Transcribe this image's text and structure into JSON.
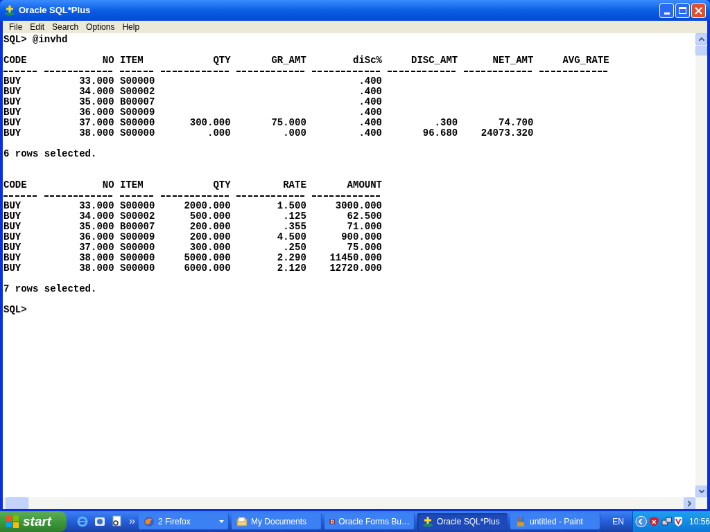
{
  "window": {
    "title": "Oracle SQL*Plus"
  },
  "menu": [
    "File",
    "Edit",
    "Search",
    "Options",
    "Help"
  ],
  "console": {
    "command_line": {
      "prompt": "SQL>",
      "command": "@invhd"
    },
    "results": [
      {
        "columns": [
          {
            "name": "CODE",
            "kind": "text"
          },
          {
            "name": "NO",
            "kind": "number"
          },
          {
            "name": "ITEM",
            "kind": "text"
          },
          {
            "name": "QTY",
            "kind": "number"
          },
          {
            "name": "GR_AMT",
            "kind": "number"
          },
          {
            "name": "diSc%",
            "kind": "number"
          },
          {
            "name": "DISC_AMT",
            "kind": "number"
          },
          {
            "name": "NET_AMT",
            "kind": "number"
          },
          {
            "name": "AVG_RATE",
            "kind": "number"
          }
        ],
        "rows": [
          [
            "BUY",
            "33.000",
            "S00000",
            null,
            null,
            ".400",
            null,
            null,
            null
          ],
          [
            "BUY",
            "34.000",
            "S00002",
            null,
            null,
            ".400",
            null,
            null,
            null
          ],
          [
            "BUY",
            "35.000",
            "B00007",
            null,
            null,
            ".400",
            null,
            null,
            null
          ],
          [
            "BUY",
            "36.000",
            "S00009",
            null,
            null,
            ".400",
            null,
            null,
            null
          ],
          [
            "BUY",
            "37.000",
            "S00000",
            "300.000",
            "75.000",
            ".400",
            ".300",
            "74.700",
            null
          ],
          [
            "BUY",
            "38.000",
            "S00000",
            ".000",
            ".000",
            ".400",
            "96.680",
            "24073.320",
            null
          ]
        ],
        "footer": "6 rows selected."
      },
      {
        "columns": [
          {
            "name": "CODE",
            "kind": "text"
          },
          {
            "name": "NO",
            "kind": "number"
          },
          {
            "name": "ITEM",
            "kind": "text"
          },
          {
            "name": "QTY",
            "kind": "number"
          },
          {
            "name": "RATE",
            "kind": "number"
          },
          {
            "name": "AMOUNT",
            "kind": "number"
          }
        ],
        "rows": [
          [
            "BUY",
            "33.000",
            "S00000",
            "2000.000",
            "1.500",
            "3000.000"
          ],
          [
            "BUY",
            "34.000",
            "S00002",
            "500.000",
            ".125",
            "62.500"
          ],
          [
            "BUY",
            "35.000",
            "B00007",
            "200.000",
            ".355",
            "71.000"
          ],
          [
            "BUY",
            "36.000",
            "S00009",
            "200.000",
            "4.500",
            "900.000"
          ],
          [
            "BUY",
            "37.000",
            "S00000",
            "300.000",
            ".250",
            "75.000"
          ],
          [
            "BUY",
            "38.000",
            "S00000",
            "5000.000",
            "2.290",
            "11450.000"
          ],
          [
            "BUY",
            "38.000",
            "S00000",
            "6000.000",
            "2.120",
            "12720.000"
          ]
        ],
        "footer": "7 rows selected."
      }
    ],
    "final_prompt": "SQL>"
  },
  "taskbar": {
    "start_label": "start",
    "tasks": [
      {
        "label": "2 Firefox",
        "kind": "firefox",
        "selected": false,
        "grouped": true
      },
      {
        "label": "My Documents",
        "kind": "folder",
        "selected": false,
        "grouped": false
      },
      {
        "label": "Oracle Forms Bu…",
        "kind": "forms",
        "selected": false,
        "grouped": false
      },
      {
        "label": "Oracle SQL*Plus",
        "kind": "sqlplus",
        "selected": true,
        "grouped": false
      },
      {
        "label": "untitled - Paint",
        "kind": "paint",
        "selected": false,
        "grouped": false
      }
    ],
    "language": "EN",
    "clock": "10:56"
  }
}
